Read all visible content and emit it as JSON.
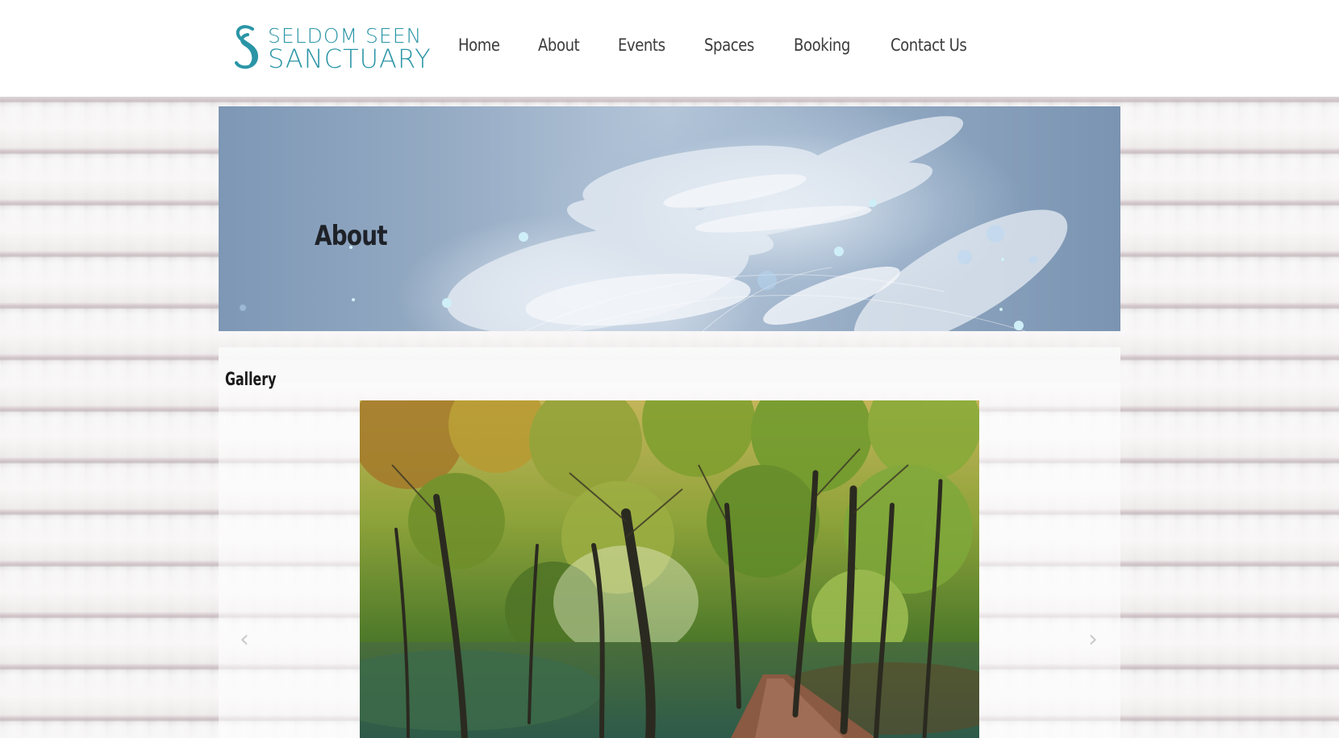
{
  "header": {
    "logo": {
      "line1": "SELDOM SEEN",
      "line2": "SANCTUARY",
      "color": "#2a95a6"
    },
    "nav": [
      {
        "label": "Home"
      },
      {
        "label": "About"
      },
      {
        "label": "Events"
      },
      {
        "label": "Spaces"
      },
      {
        "label": "Booking"
      },
      {
        "label": "Contact Us"
      }
    ]
  },
  "banner": {
    "title": "About",
    "image": "hands-stacked-together"
  },
  "gallery": {
    "heading": "Gallery",
    "prev_icon": "‹",
    "next_icon": "›",
    "image": "autumn-forest-path"
  }
}
